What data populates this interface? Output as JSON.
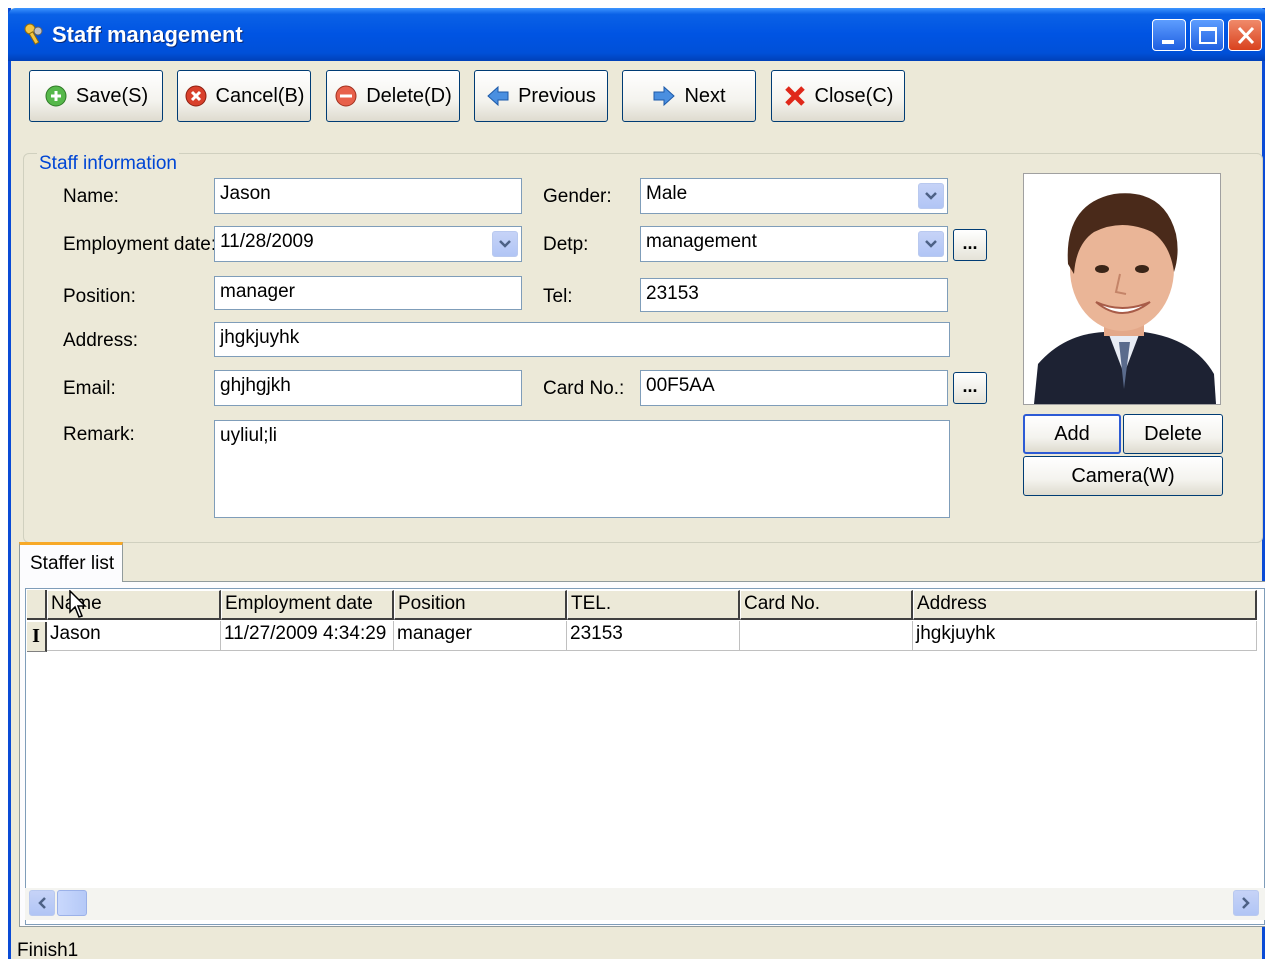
{
  "window": {
    "title": "Staff management"
  },
  "toolbar": {
    "save": "Save(S)",
    "cancel": "Cancel(B)",
    "delete": "Delete(D)",
    "previous": "Previous",
    "next": "Next",
    "close": "Close(C)"
  },
  "staff_info": {
    "legend": "Staff information",
    "name_label": "Name:",
    "name_value": "Jason",
    "gender_label": "Gender:",
    "gender_value": "Male",
    "employment_label": "Employment date:",
    "employment_value": "11/28/2009",
    "dept_label": "Detp:",
    "dept_value": "management",
    "position_label": "Position:",
    "position_value": "manager",
    "tel_label": "Tel:",
    "tel_value": "23153",
    "address_label": "Address:",
    "address_value": "jhgkjuyhk",
    "email_label": "Email:",
    "email_value": "ghjhgjkh",
    "card_label": "Card No.:",
    "card_value": "00F5AA",
    "remark_label": "Remark:",
    "remark_value": "uyliul;li",
    "dots": "..."
  },
  "photo_buttons": {
    "add": "Add",
    "delete": "Delete",
    "camera": "Camera(W)"
  },
  "tab": {
    "label": "Staffer list"
  },
  "grid": {
    "headers": [
      "Name",
      "Employment date",
      "Position",
      "TEL.",
      "Card No.",
      "Address"
    ],
    "rows": [
      {
        "indicator": "I",
        "cells": [
          "Jason",
          "11/27/2009 4:34:29",
          "manager",
          "23153",
          "",
          "jhgkjuyhk"
        ]
      }
    ]
  },
  "status": {
    "text": "Finish1"
  },
  "icons": {
    "app": "keys-icon",
    "save": "plus-circle-icon",
    "cancel": "x-circle-icon",
    "delete": "minus-circle-icon",
    "previous": "arrow-left-icon",
    "next": "arrow-right-icon",
    "close": "red-x-icon"
  },
  "colors": {
    "titlebar": "#0054e3",
    "accent_tab": "#f7a928",
    "legend_text": "#0046d5"
  }
}
